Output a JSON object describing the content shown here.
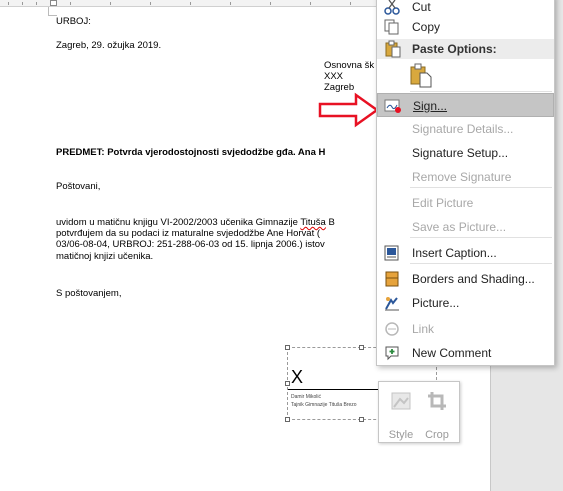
{
  "document": {
    "lines": {
      "urbroj_top": "URBOJ:",
      "date": "Zagreb, 29. ožujka 2019.",
      "recipient_1": "Osnovna šk",
      "recipient_2": "XXX",
      "recipient_3": "Zagreb",
      "subject": "PREDMET:  Potvrda vjerodostojnosti svjedodžbe gđa. Ana H",
      "greeting": "Poštovani,",
      "body_1a": "uvidom u matičnu knjigu VI-2002/2003 učenika Gimnazije ",
      "body_1b": "Tituša",
      "body_1c": " B",
      "body_2": "potvrđujem da su podaci iz maturalne svjedodžbe Ane Horvat  (",
      "body_3": "03/06-08-04, URBROJ: 251-288-06-03 od 15. lipnja 2006.) istov",
      "body_4": "matičnoj knjizi učenika.",
      "closing": "S poštovanjem,"
    },
    "signature": {
      "mark": "X",
      "name": "Damir Mikolić",
      "title": "Tajnik Gimnazije Tituša Brezo"
    }
  },
  "mini_toolbar": {
    "style_label": "Style",
    "crop_label": "Crop"
  },
  "context_menu": {
    "cut": "Cut",
    "copy": "Copy",
    "paste_options": "Paste Options:",
    "sign": "Sign...",
    "signature_details": "Signature Details...",
    "signature_setup": "Signature Setup...",
    "remove_signature": "Remove Signature",
    "edit_picture": "Edit Picture",
    "save_as_picture": "Save as Picture...",
    "insert_caption": "Insert Caption...",
    "borders_and_shading": "Borders and Shading...",
    "picture": "Picture...",
    "link": "Link",
    "new_comment": "New Comment"
  },
  "colors": {
    "highlight": "#c5c5c5",
    "arrow": "#e81123"
  }
}
